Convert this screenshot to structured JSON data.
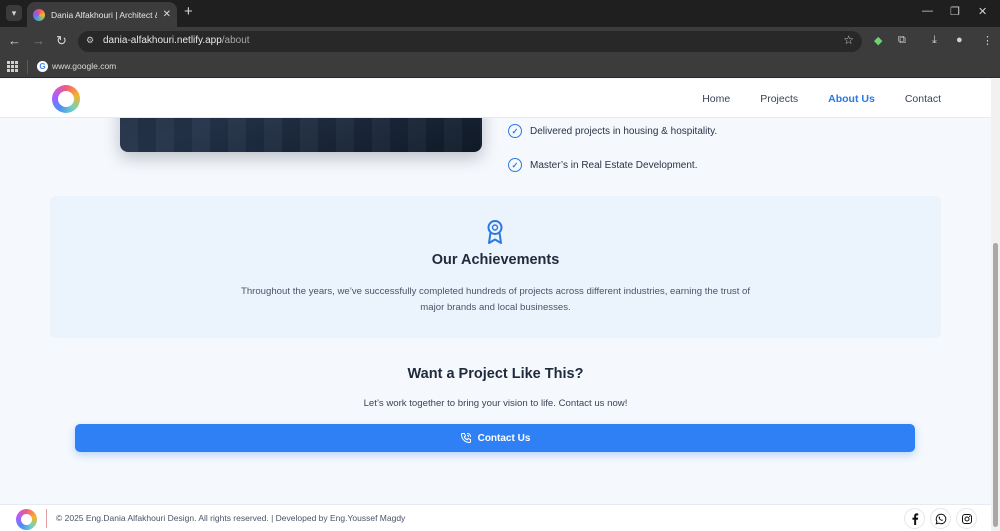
{
  "browser": {
    "tab_title": "Dania Alfakhouri | Architect & I",
    "url_host": "dania-alfakhouri.netlify.app",
    "url_path": "/about",
    "bookmark_label": "www.google.com"
  },
  "header": {
    "nav": [
      {
        "label": "Home"
      },
      {
        "label": "Projects"
      },
      {
        "label": "About Us"
      },
      {
        "label": "Contact"
      }
    ],
    "active_nav": "About Us"
  },
  "about": {
    "checks": [
      "Delivered projects in housing & hospitality.",
      "Master’s in Real Estate Development."
    ]
  },
  "achievements": {
    "title": "Our Achievements",
    "text": "Throughout the years, we’ve successfully completed hundreds of projects across different industries, earning the trust of major brands and local businesses."
  },
  "cta": {
    "title": "Want a Project Like This?",
    "text": "Let’s work together to bring your vision to life. Contact us now!",
    "button_label": "Contact Us"
  },
  "footer": {
    "text": "© 2025 Eng.Dania Alfakhouri Design. All rights reserved. | Developed by Eng.Youssef Magdy",
    "social": [
      "facebook-icon",
      "whatsapp-icon",
      "instagram-icon"
    ]
  },
  "colors": {
    "accent": "#2f80f5",
    "nav_active": "#2a78e4",
    "achievement_bg": "#ebf3fd",
    "page_bg": "#f5f8fc"
  }
}
